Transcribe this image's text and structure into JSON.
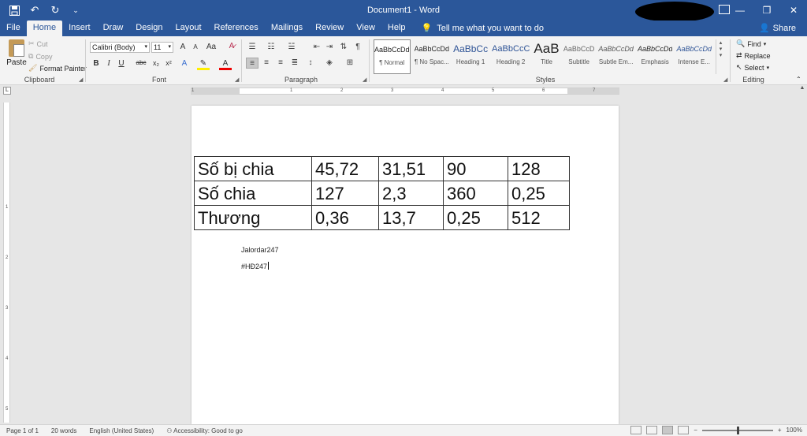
{
  "window": {
    "doc_title": "Document1 - Word",
    "qat_icons": [
      "save-icon",
      "undo-icon",
      "redo-icon",
      "customize-qat-icon"
    ]
  },
  "tabs": [
    "File",
    "Home",
    "Insert",
    "Draw",
    "Design",
    "Layout",
    "References",
    "Mailings",
    "Review",
    "View",
    "Help"
  ],
  "active_tab": "Home",
  "tell_me": "Tell me what you want to do",
  "share_label": "Share",
  "clipboard": {
    "paste": "Paste",
    "cut": "Cut",
    "copy": "Copy",
    "format_painter": "Format Painter",
    "group": "Clipboard"
  },
  "font": {
    "name": "Calibri (Body)",
    "size": "11",
    "group": "Font",
    "buttons": [
      "A",
      "A",
      "Aa",
      "B",
      "I",
      "U",
      "abc",
      "x₂",
      "x²",
      "A",
      "A"
    ]
  },
  "paragraph": {
    "group": "Paragraph"
  },
  "styles": {
    "group": "Styles",
    "items": [
      {
        "preview": "AaBbCcDd",
        "name": "¶ Normal"
      },
      {
        "preview": "AaBbCcDd",
        "name": "¶ No Spac..."
      },
      {
        "preview": "AaBbCc",
        "name": "Heading 1"
      },
      {
        "preview": "AaBbCcC",
        "name": "Heading 2"
      },
      {
        "preview": "AaB",
        "name": "Title"
      },
      {
        "preview": "AaBbCcD",
        "name": "Subtitle"
      },
      {
        "preview": "AaBbCcDd",
        "name": "Subtle Em..."
      },
      {
        "preview": "AaBbCcDd",
        "name": "Emphasis"
      },
      {
        "preview": "AaBbCcDd",
        "name": "Intense E..."
      }
    ]
  },
  "editing": {
    "find": "Find",
    "replace": "Replace",
    "select": "Select",
    "group": "Editing"
  },
  "ruler": {
    "labels": [
      "1",
      "1",
      "2",
      "3",
      "4",
      "5",
      "6",
      "7"
    ],
    "vlabels": [
      "1",
      "2",
      "3",
      "4",
      "5"
    ]
  },
  "table": {
    "rows": [
      [
        "Số bị chia",
        "45,72",
        "31,51",
        "90",
        "128"
      ],
      [
        "Số chia",
        "127",
        "2,3",
        "360",
        "0,25"
      ],
      [
        "Thương",
        "0,36",
        "13,7",
        "0,25",
        "512"
      ]
    ]
  },
  "paragraphs": [
    "Jalordar247",
    "#HĐ247"
  ],
  "status": {
    "page": "Page 1 of 1",
    "words": "20 words",
    "language": "English (United States)",
    "accessibility": "Accessibility: Good to go",
    "zoom": "100%"
  }
}
